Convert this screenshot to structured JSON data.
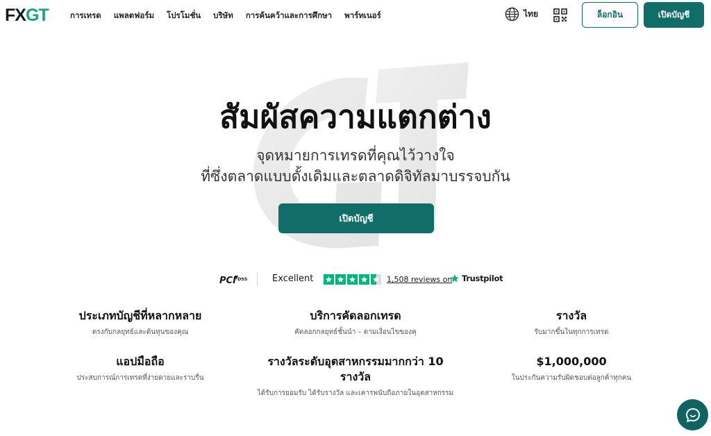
{
  "brand": {
    "logo_dark": "FX",
    "logo_accent": "GT",
    "accent_color": "#14a37f",
    "primary_color": "#106d68"
  },
  "nav": {
    "items": [
      {
        "label": "การเทรด"
      },
      {
        "label": "แพลตฟอร์ม"
      },
      {
        "label": "โปรโมชั่น"
      },
      {
        "label": "บริษัท"
      },
      {
        "label": "การค้นคว้าและการศึกษา"
      },
      {
        "label": "พาร์ทเนอร์"
      }
    ],
    "language": {
      "label": "ไทย",
      "icon": "globe-icon"
    },
    "qr_icon": "qr-code-icon",
    "login_label": "ล็อกอิน",
    "open_account_label": "เปิดบัญชี"
  },
  "hero": {
    "title": "สัมผัสความแตกต่าง",
    "subtitle_line1": "จุดหมายการเทรดที่คุณไว้วางใจ",
    "subtitle_line2": "ที่ซึ่งตลาดแบบดั้งเดิมและตลาดดิจิทัลมาบรรจบกัน",
    "cta_label": "เปิดบัญชี"
  },
  "trust": {
    "pci_logo_text": "DSS",
    "rating_word": "Excellent",
    "stars": 4.5,
    "reviews_text": "1,508 reviews on",
    "platform_name": "Trustpilot"
  },
  "features": [
    {
      "title": "ประเภทบัญชีที่หลากหลาย",
      "desc": "ตรงกับกลยุทธ์และต้นทุนของคุณ"
    },
    {
      "title": "บริการคัดลอกเทรด",
      "desc": "คัดลอกกลยุทธ์ชั้นนำ – ตามเงื่อนไขของคุ"
    },
    {
      "title": "รางวัล",
      "desc": "รับมากขึ้นในทุกการเทรด"
    },
    {
      "title": "แอปมือถือ",
      "desc": "ประสบการณ์การเทรดที่ง่ายดายและราบรื่น"
    },
    {
      "title": "รางวัลระดับอุตสาหกรรมมากกว่า 10 รางวัล",
      "desc": "ได้รับการยอมรับ ได้รับรางวัล และเคารพนับถือภายในอุตสาหกรรม"
    },
    {
      "title": "$1,000,000",
      "desc": "ในประกันความรับผิดชอบต่อลูกค้าทุกคน"
    }
  ],
  "chat": {
    "icon": "chat-bubble-icon"
  }
}
